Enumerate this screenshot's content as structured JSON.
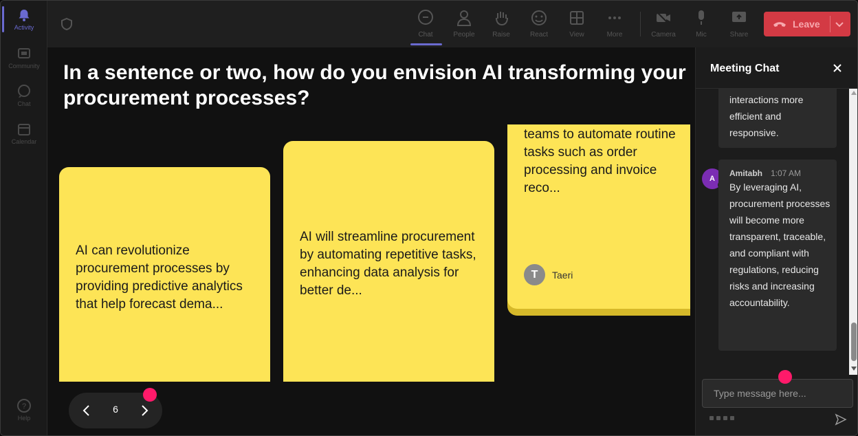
{
  "rail": {
    "items": [
      {
        "label": "Activity",
        "icon": "bell-icon"
      },
      {
        "label": "Community",
        "icon": "community-icon"
      },
      {
        "label": "Chat",
        "icon": "chat-icon"
      },
      {
        "label": "Calendar",
        "icon": "calendar-icon"
      },
      {
        "label": "Help",
        "icon": "help-icon"
      }
    ]
  },
  "toolbar": {
    "chat": "Chat",
    "people": "People",
    "raise": "Raise",
    "react": "React",
    "view": "View",
    "more": "More",
    "camera": "Camera",
    "mic": "Mic",
    "share": "Share",
    "leave": "Leave"
  },
  "stage": {
    "question": "In a sentence or two, how do you envision AI transforming your procurement processes?",
    "notes": [
      {
        "text": "AI can revolutionize procurement processes by providing predictive analytics that help forecast dema..."
      },
      {
        "text": "AI will streamline procurement by automating repetitive tasks, enhancing data analysis for better de..."
      },
      {
        "text": "teams to automate routine tasks such as order processing and invoice reco...",
        "author_initial": "T",
        "author": "Taeri"
      }
    ],
    "page": "6"
  },
  "chat": {
    "title": "Meeting Chat",
    "messages": [
      {
        "body": "interactions more efficient and responsive."
      },
      {
        "sender": "Amitabh",
        "initial": "A",
        "time": "1:07 AM",
        "body": "By leveraging AI, procurement processes will become more transparent, traceable, and compliant with regulations, reducing risks and increasing accountability."
      }
    ],
    "input_placeholder": "Type message here..."
  },
  "colors": {
    "note": "#fde456",
    "leave": "#d33a44",
    "accent": "#6a6ad0",
    "marker": "#ff1a6a",
    "avatar": "#7b2db3"
  }
}
